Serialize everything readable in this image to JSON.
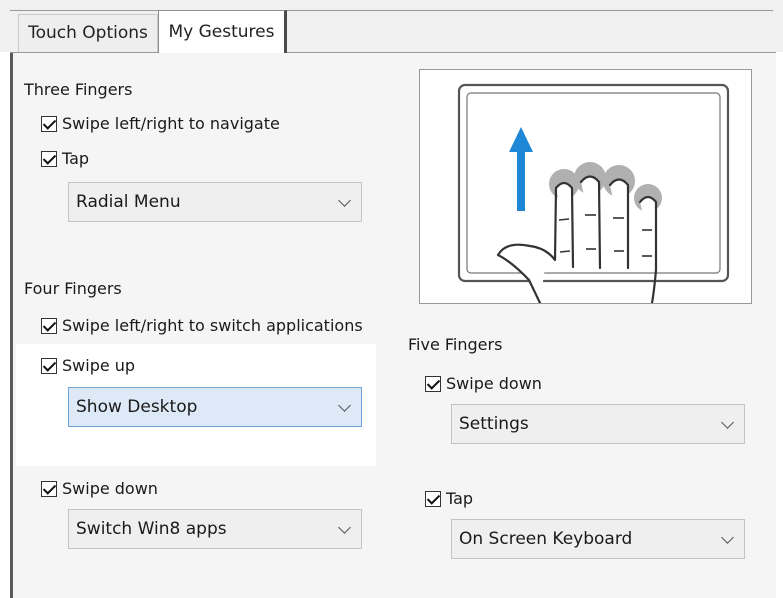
{
  "tabs": [
    {
      "label": "Touch Options"
    },
    {
      "label": "My Gestures"
    }
  ],
  "three_fingers": {
    "title": "Three Fingers",
    "swipe": {
      "label": "Swipe left/right to navigate",
      "checked": true
    },
    "tap": {
      "label": "Tap",
      "checked": true,
      "value": "Radial Menu"
    }
  },
  "four_fingers": {
    "title": "Four Fingers",
    "swipe_lr": {
      "label": "Swipe left/right to switch applications",
      "checked": true
    },
    "swipe_up": {
      "label": "Swipe up",
      "checked": true,
      "value": "Show Desktop"
    },
    "swipe_down": {
      "label": "Swipe down",
      "checked": true,
      "value": "Switch Win8 apps"
    }
  },
  "five_fingers": {
    "title": "Five Fingers",
    "swipe_down": {
      "label": "Swipe down",
      "checked": true,
      "value": "Settings"
    },
    "tap": {
      "label": "Tap",
      "checked": true,
      "value": "On Screen Keyboard"
    }
  },
  "preview": {
    "icon": "four-finger-swipe-up-icon",
    "arrow_color": "#1e88d6",
    "finger_tip_color": "#b0b0b0"
  }
}
